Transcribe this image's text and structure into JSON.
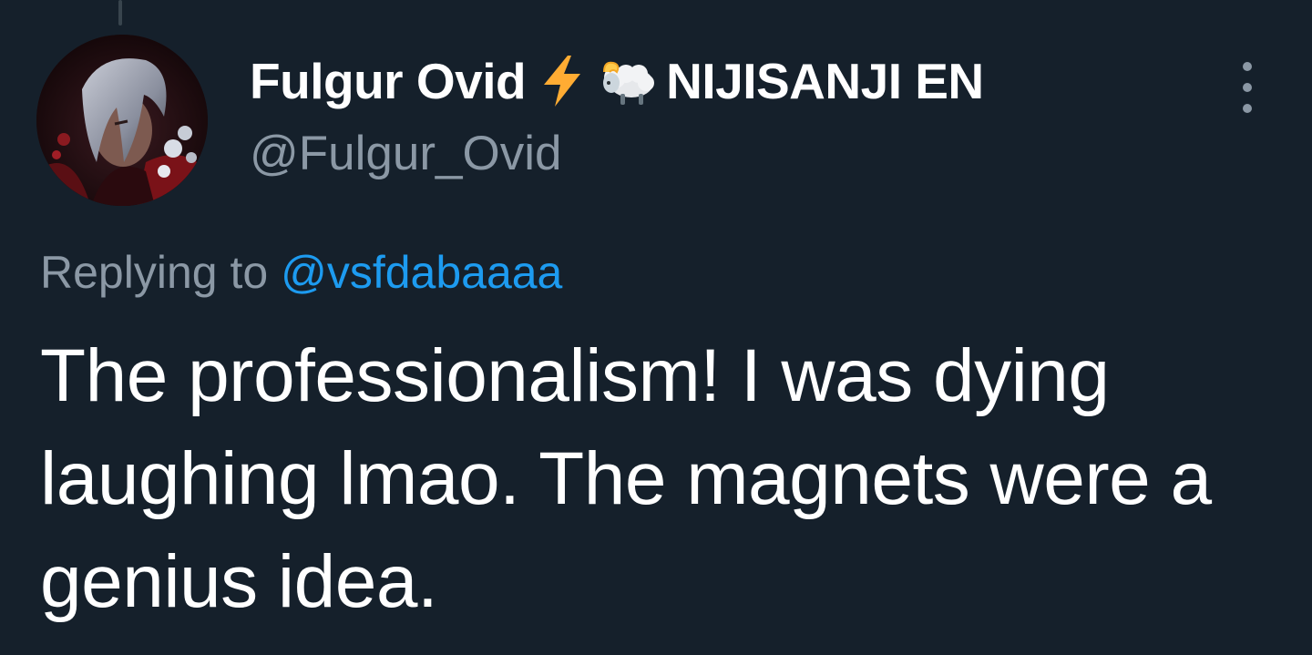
{
  "tweet": {
    "display_name": "Fulgur Ovid",
    "name_emojis": [
      "lightning-emoji",
      "ram-emoji"
    ],
    "org_name": "NIJISANJI EN",
    "handle": "@Fulgur_Ovid",
    "replying_prefix": "Replying to",
    "replying_to": "@vsfdabaaaa",
    "text": "The professionalism! I was dying laughing lmao. The magnets were a genius idea.",
    "avatar_icon": "avatar-portrait",
    "more_icon": "more-vertical-icon"
  },
  "colors": {
    "background": "#15202b",
    "primary_text": "#ffffff",
    "secondary_text": "#8b98a5",
    "link": "#1d9bf0",
    "lightning": "#ffac33"
  }
}
